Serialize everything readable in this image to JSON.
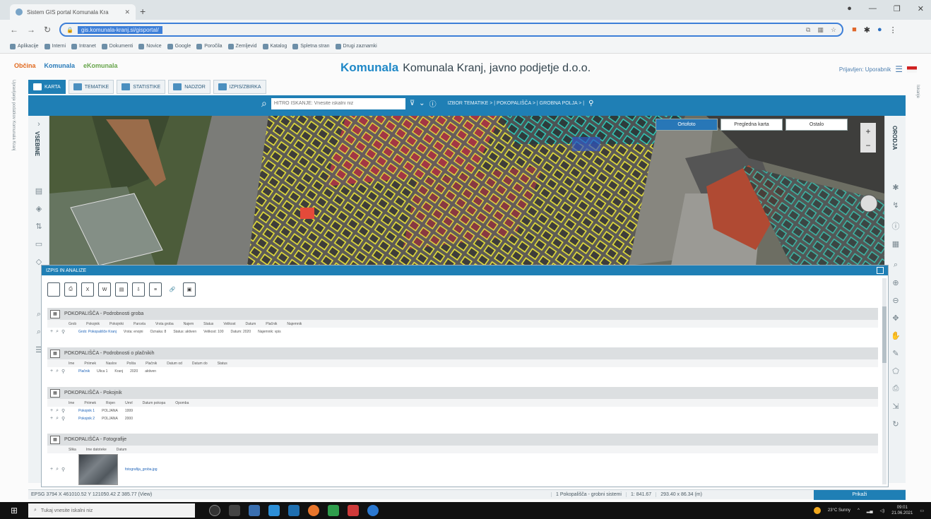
{
  "browser": {
    "tab_title": "Sistem GIS portal Komunala Kra",
    "address": "gis.komunala-kranj.si/gisportal/",
    "bookmarks": [
      "Aplikacije",
      "Interni",
      "Intranet",
      "Dokumenti",
      "Novice",
      "Google",
      "Poročila",
      "Zemljevid",
      "Katalog",
      "Spletna stran",
      "Drugi zaznamki"
    ]
  },
  "app": {
    "brands": [
      "Občina",
      "Komunala",
      "eKomunala"
    ],
    "logo": "Komunala",
    "company": "Komunala Kranj, javno podjetje d.o.o.",
    "user": "Prijavljen: Uporabnik"
  },
  "tabs": [
    {
      "label": "KARTA",
      "active": true
    },
    {
      "label": "TEMATIKE",
      "active": false
    },
    {
      "label": "STATISTIKE",
      "active": false
    },
    {
      "label": "NADZOR",
      "active": false
    },
    {
      "label": "IZPIS/ZBIRKA",
      "active": false
    }
  ],
  "search": {
    "placeholder": "HITRO ISKANJE: Vnesite iskalni niz",
    "crumbs": "IZBOR TEMATIKE > | POKOPALIŠČA > | GROBNA POLJA > |"
  },
  "map": {
    "buttons": [
      "Ortofoto",
      "Pregledna karta",
      "Ostalo"
    ]
  },
  "left_panel": {
    "label": "VSEBINE",
    "outer_label": "Upravljanje podatkov Komunala Kranj"
  },
  "right_panel": {
    "label": "ORODJA",
    "outer_label": "Iskanje"
  },
  "results": {
    "title": "IZPIS IN ANALIZE",
    "toolbar_icons": [
      "new-doc-icon",
      "print-icon",
      "excel-icon",
      "word-icon",
      "pdf-icon",
      "export-icon",
      "list-icon",
      "link-icon",
      "image-icon"
    ],
    "sections": [
      {
        "title": "POKOPALIŠČA - Podrobnosti groba",
        "columns": [
          "Grob",
          "Pokojnik",
          "Pokojniki",
          "Parcela",
          "Vrsta groba",
          "Najem",
          "Status",
          "Velikost",
          "Datum",
          "Plačnik",
          "Najemnik"
        ],
        "rows": [
          [
            "Grob: Pokopališče Kranj",
            "Vrsta: enojni",
            "Oznaka: 8",
            "Status: aktiven",
            "Velikost: 100",
            "Datum: 2020",
            "Najemnik: vpis"
          ]
        ]
      },
      {
        "title": "POKOPALIŠČA - Podrobnosti o plačnikih",
        "columns": [
          "Ime",
          "Priimek",
          "Naslov",
          "Pošta",
          "Plačnik",
          "Datum od",
          "Datum do",
          "Status"
        ],
        "rows": [
          [
            "Plačnik",
            "Ulica 1",
            "Kranj",
            "2020",
            "aktiven"
          ]
        ]
      },
      {
        "title": "POKOPALIŠČA - Pokojnik",
        "columns": [
          "Ime",
          "Priimek",
          "Rojen",
          "Umrl",
          "Datum pokopa",
          "Opomba"
        ],
        "rows": [
          [
            "Pokojnik 1",
            "POLJANA",
            "1999"
          ],
          [
            "Pokojnik 2",
            "POLJANA",
            "2000"
          ]
        ]
      },
      {
        "title": "POKOPALIŠČA - Fotografije",
        "columns": [
          "Slika",
          "Ime datoteke",
          "Datum"
        ],
        "rows": [
          [
            "fotografija_groba.jpg"
          ]
        ]
      }
    ]
  },
  "status": {
    "coords": "EPSG 3794 X 461010.52 Y 121050.42 Z 385.77 (View)",
    "layer": "1 Pokopališča - grobni sistemi",
    "scale": "1: 841.67",
    "size": "293.40 x 86.34 (m)",
    "button": "Prikaži"
  },
  "taskbar": {
    "search_placeholder": "Tukaj vnesite iskalni niz",
    "weather": "23°C Sunny",
    "time": "09:01",
    "date": "21.06.2021"
  }
}
